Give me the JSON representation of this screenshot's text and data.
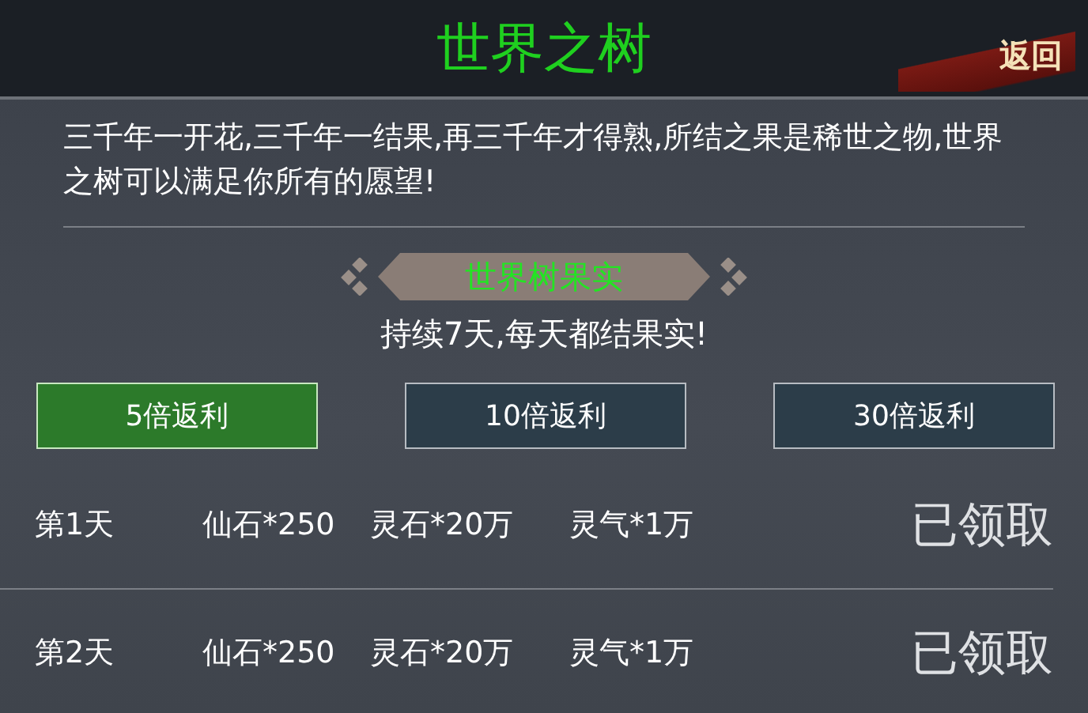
{
  "header": {
    "title": "世界之树",
    "back_button": "返回"
  },
  "description": "三千年一开花,三千年一结果,再三千年才得熟,所结之果是稀世之物,世界之树可以满足你所有的愿望!",
  "banner": "世界树果实",
  "subtitle": "持续7天,每天都结果实!",
  "tabs": [
    {
      "label": "5倍返利",
      "selected": true
    },
    {
      "label": "10倍返利",
      "selected": false
    },
    {
      "label": "30倍返利",
      "selected": false
    }
  ],
  "rows": [
    {
      "day": "第1天",
      "rewards": [
        "仙石*250",
        "灵石*20万",
        "灵气*1万"
      ],
      "status": "已领取"
    },
    {
      "day": "第2天",
      "rewards": [
        "仙石*250",
        "灵石*20万",
        "灵气*1万"
      ],
      "status": "已领取"
    }
  ]
}
